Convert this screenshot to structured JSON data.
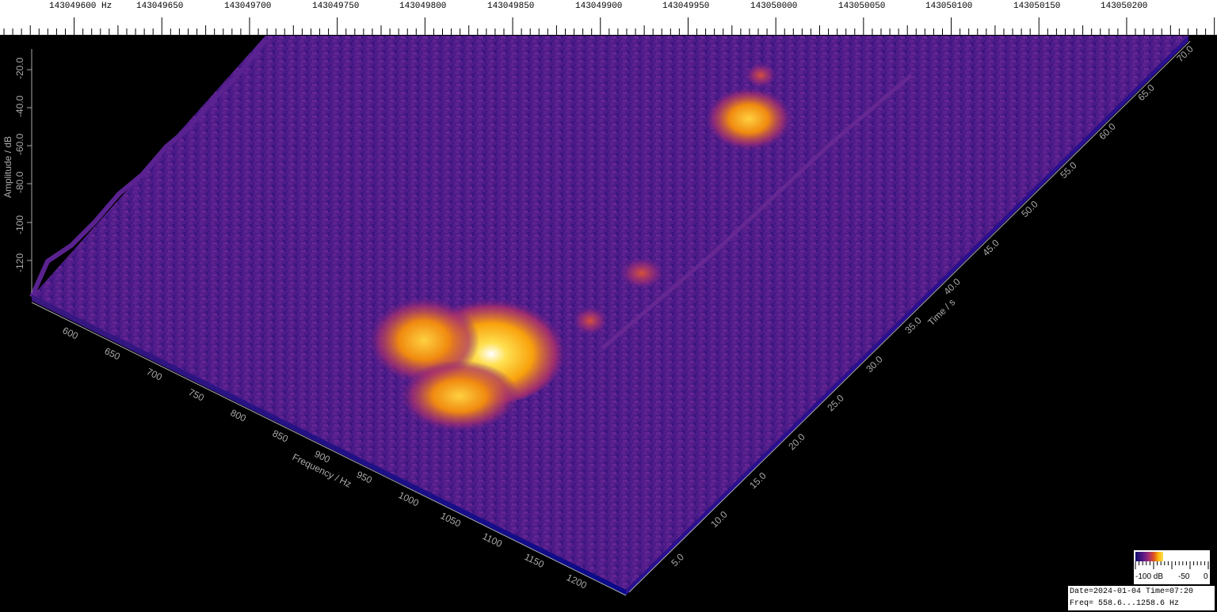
{
  "freq_ruler": {
    "labels": [
      "143049600 Hz",
      "143049650",
      "143049700",
      "143049750",
      "143049800",
      "143049850",
      "143049900",
      "143049950",
      "143050000",
      "143050050",
      "143050100",
      "143050150",
      "143050200"
    ]
  },
  "amplitude_axis": {
    "title": "Amplitude / dB",
    "ticks": [
      "-20.0",
      "-40.0",
      "-60.0",
      "-80.0",
      "-100",
      "-120"
    ]
  },
  "frequency_axis": {
    "title": "Frequency / Hz",
    "ticks": [
      "600",
      "650",
      "700",
      "750",
      "800",
      "850",
      "900",
      "950",
      "1000",
      "1050",
      "1100",
      "1150",
      "1200"
    ]
  },
  "time_axis": {
    "title": "Time / s",
    "ticks": [
      "5.0",
      "10.0",
      "15.0",
      "20.0",
      "25.0",
      "30.0",
      "35.0",
      "40.0",
      "45.0",
      "50.0",
      "55.0",
      "60.0",
      "65.0",
      "70.0"
    ]
  },
  "colorbar": {
    "labels": [
      "-100 dB",
      "-50",
      "0"
    ],
    "colors": [
      "#0c0a6a",
      "#3a137c",
      "#6a1e86",
      "#a8306e",
      "#e0541c",
      "#fbb50a",
      "#ffe050"
    ]
  },
  "info": {
    "line1": "Date=2024-01-04 Time=07:20",
    "line2": "Freq= 558.6...1258.6 Hz"
  }
}
